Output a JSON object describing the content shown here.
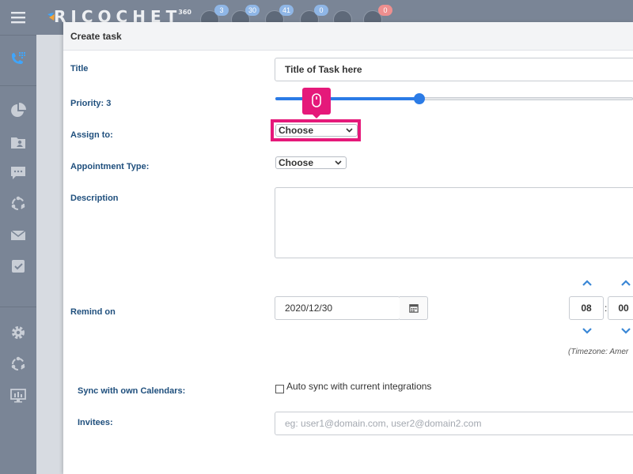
{
  "app": {
    "logo_text": "RICOCHET",
    "logo_sup": "360",
    "top_badges": [
      "3",
      "30",
      "41",
      "0",
      "0"
    ]
  },
  "panel": {
    "title": "Create task"
  },
  "form": {
    "title_label": "Title",
    "title_value": "Title of Task here",
    "priority_label": "Priority: 3",
    "priority_fraction": 0.4,
    "assign_label": "Assign to:",
    "assign_value": "Choose",
    "appt_label": "Appointment Type:",
    "appt_value": "Choose",
    "desc_label": "Description",
    "remind_label": "Remind on",
    "remind_date": "2020/12/30",
    "remind_hour": "08",
    "remind_sep": ":",
    "remind_min": "00",
    "timezone_text": "(Timezone: Amer",
    "sync_label": "Sync with own Calendars:",
    "sync_checkbox_text": "Auto sync with current integrations",
    "invitees_label": "Invitees:",
    "invitees_placeholder": "eg: user1@domain.com, user2@domain2.com"
  },
  "colors": {
    "sidebar": "#7a8596",
    "label": "#1f4f7d",
    "accent": "#2b7be6",
    "highlight": "#e5197a"
  }
}
